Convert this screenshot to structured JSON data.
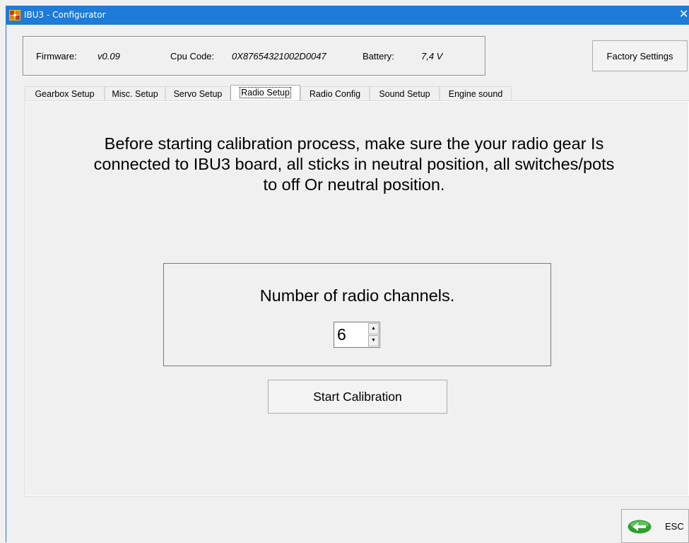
{
  "window": {
    "title": "IBU3 - Configurator",
    "close_glyph": "✕"
  },
  "info": {
    "firmware_label": "Firmware:",
    "firmware_value": "v0.09",
    "cpu_label": "Cpu Code:",
    "cpu_value": "0X87654321002D0047",
    "battery_label": "Battery:",
    "battery_value": "7,4 V"
  },
  "header": {
    "factory_button_label": "Factory Settings"
  },
  "tabs": [
    {
      "label": "Gearbox Setup",
      "active": false
    },
    {
      "label": "Misc. Setup",
      "active": false
    },
    {
      "label": "Servo Setup",
      "active": false
    },
    {
      "label": "Radio Setup",
      "active": true
    },
    {
      "label": "Radio Config",
      "active": false
    },
    {
      "label": "Sound Setup",
      "active": false
    },
    {
      "label": "Engine sound",
      "active": false
    }
  ],
  "radio_setup": {
    "instructions": "Before starting calibration process, make sure the your radio gear Is connected to IBU3 board, all sticks in neutral position, all switches/pots to off Or neutral position.",
    "channels_label": "Number of radio channels.",
    "channels_value": "6",
    "start_button_label": "Start Calibration"
  },
  "footer": {
    "esc_label": "ESC"
  },
  "icons": {
    "app": "app-logo-icon",
    "close": "close-icon",
    "stepper_up": "spin-up-icon",
    "stepper_down": "spin-down-icon",
    "back": "back-arrow-icon"
  },
  "colors": {
    "titlebar": "#1e7bd7",
    "window_bg": "#f0f0f0",
    "back_icon_green": "#2e9e2e"
  }
}
